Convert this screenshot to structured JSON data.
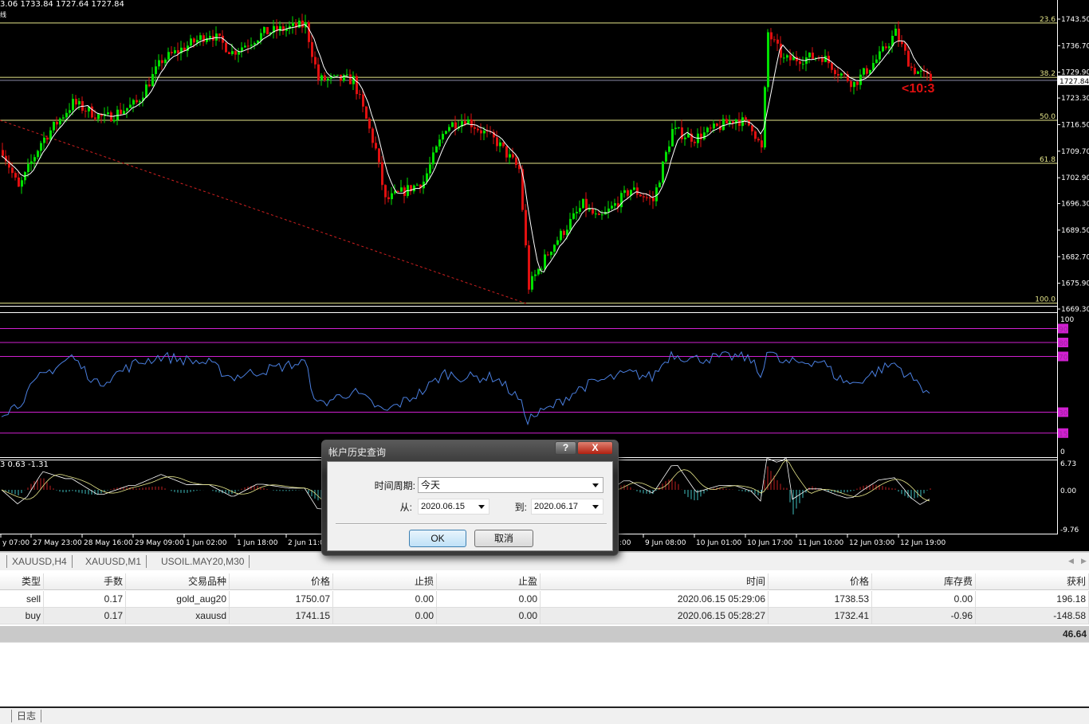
{
  "chart": {
    "ohlc_text": "3.06 1733.84 1727.64 1727.84",
    "sub_label": "线",
    "annotation": "<10:3",
    "macd_text": "3 0.63 -1.31",
    "current_price": "1727.84",
    "colors": {
      "bull": "#00e000",
      "bear": "#e01010",
      "fib": "#e6e68a",
      "level": "#d020d0",
      "rsi": "#4a7fe0",
      "macd_pos": "#c02020",
      "macd_neg": "#40c0c0",
      "annotation": "#e01010"
    }
  },
  "chart_data": [
    {
      "type": "candlestick",
      "title": "XAUUSD,H1",
      "price_axis": [
        "1743.50",
        "1736.70",
        "1729.90",
        "1723.30",
        "1716.50",
        "1709.70",
        "1702.90",
        "1696.30",
        "1689.50",
        "1682.70",
        "1675.90",
        "1669.30"
      ],
      "ylim": [
        1669.3,
        1743.5
      ],
      "fib_levels": [
        {
          "label": "23.6",
          "price": 1742.5
        },
        {
          "label": "38.2",
          "price": 1728.6
        },
        {
          "label": "50.0",
          "price": 1717.6
        },
        {
          "label": "61.8",
          "price": 1706.6
        },
        {
          "label": "100.0",
          "price": 1670.8
        }
      ],
      "close_path_by_bar": [
        [
          0,
          1710
        ],
        [
          5,
          1700
        ],
        [
          12,
          1712
        ],
        [
          22,
          1722
        ],
        [
          32,
          1718
        ],
        [
          42,
          1722
        ],
        [
          50,
          1733
        ],
        [
          65,
          1740
        ],
        [
          72,
          1735
        ],
        [
          82,
          1740
        ],
        [
          95,
          1742
        ],
        [
          99,
          1728
        ],
        [
          110,
          1728
        ],
        [
          117,
          1710
        ],
        [
          120,
          1697
        ],
        [
          132,
          1702
        ],
        [
          139,
          1716
        ],
        [
          145,
          1718
        ],
        [
          155,
          1712
        ],
        [
          162,
          1705
        ],
        [
          165,
          1675
        ],
        [
          172,
          1685
        ],
        [
          182,
          1696
        ],
        [
          187,
          1692
        ],
        [
          197,
          1700
        ],
        [
          204,
          1697
        ],
        [
          210,
          1715
        ],
        [
          217,
          1713
        ],
        [
          230,
          1718
        ],
        [
          235,
          1716
        ],
        [
          238,
          1710
        ],
        [
          240,
          1740
        ],
        [
          245,
          1733
        ],
        [
          257,
          1734
        ],
        [
          262,
          1730
        ],
        [
          267,
          1727
        ],
        [
          275,
          1734
        ],
        [
          280,
          1740
        ],
        [
          285,
          1731
        ],
        [
          291,
          1728
        ]
      ],
      "time_labels": [
        "y 07:00",
        "27 May 23:00",
        "28 May 16:00",
        "29 May 09:00",
        "1 Jun 02:00",
        "1 Jun 18:00",
        "2 Jun 11:00",
        ":00",
        "9 Jun 08:00",
        "10 Jun 01:00",
        "10 Jun 17:00",
        "11 Jun 10:00",
        "12 Jun 03:00",
        "12 Jun 19:00"
      ]
    },
    {
      "type": "line",
      "title": "RSI",
      "ylim": [
        0,
        100
      ],
      "axis_labels": [
        "100",
        "0"
      ],
      "levels": [
        "90",
        "80",
        "70",
        "30",
        "15"
      ],
      "level_values": [
        90,
        80,
        70,
        30,
        15
      ],
      "values_by_bar": [
        [
          0,
          30
        ],
        [
          5,
          35
        ],
        [
          12,
          55
        ],
        [
          22,
          70
        ],
        [
          30,
          50
        ],
        [
          42,
          65
        ],
        [
          50,
          70
        ],
        [
          65,
          65
        ],
        [
          72,
          55
        ],
        [
          82,
          60
        ],
        [
          95,
          66
        ],
        [
          99,
          35
        ],
        [
          110,
          45
        ],
        [
          117,
          35
        ],
        [
          120,
          30
        ],
        [
          132,
          45
        ],
        [
          139,
          58
        ],
        [
          145,
          55
        ],
        [
          155,
          55
        ],
        [
          162,
          40
        ],
        [
          165,
          25
        ],
        [
          172,
          33
        ],
        [
          182,
          48
        ],
        [
          187,
          52
        ],
        [
          197,
          58
        ],
        [
          204,
          55
        ],
        [
          210,
          72
        ],
        [
          217,
          68
        ],
        [
          230,
          70
        ],
        [
          235,
          68
        ],
        [
          238,
          55
        ],
        [
          240,
          75
        ],
        [
          245,
          65
        ],
        [
          257,
          67
        ],
        [
          262,
          55
        ],
        [
          267,
          50
        ],
        [
          275,
          60
        ],
        [
          280,
          65
        ],
        [
          285,
          55
        ],
        [
          291,
          44
        ]
      ]
    },
    {
      "type": "bar",
      "title": "MACD",
      "ylim": [
        -9.76,
        6.73
      ],
      "axis_labels": [
        "6.73",
        "0.00",
        "-9.76"
      ]
    }
  ],
  "tabs": [
    "XAUUSD,H4",
    "XAUUSD,M1",
    "USOIL.MAY20,M30"
  ],
  "table": {
    "headers": [
      "类型",
      "手数",
      "交易品种",
      "价格",
      "止损",
      "止盈",
      "时间",
      "价格",
      "库存费",
      "获利"
    ],
    "rows": [
      [
        "sell",
        "0.17",
        "gold_aug20",
        "1750.07",
        "0.00",
        "0.00",
        "2020.06.15 05:29:06",
        "1738.53",
        "0.00",
        "196.18"
      ],
      [
        "buy",
        "0.17",
        "xauusd",
        "1741.15",
        "0.00",
        "0.00",
        "2020.06.15 05:28:27",
        "1732.41",
        "-0.96",
        "-148.58"
      ]
    ],
    "total": "46.64"
  },
  "bottom_tabs": [
    "日志"
  ],
  "dialog": {
    "title": "帐户历史查询",
    "help": "?",
    "close": "X",
    "period_label": "时间周期:",
    "period_value": "今天",
    "from_label": "从:",
    "from_value": "2020.06.15",
    "to_label": "到:",
    "to_value": "2020.06.17",
    "ok": "OK",
    "cancel": "取消"
  }
}
